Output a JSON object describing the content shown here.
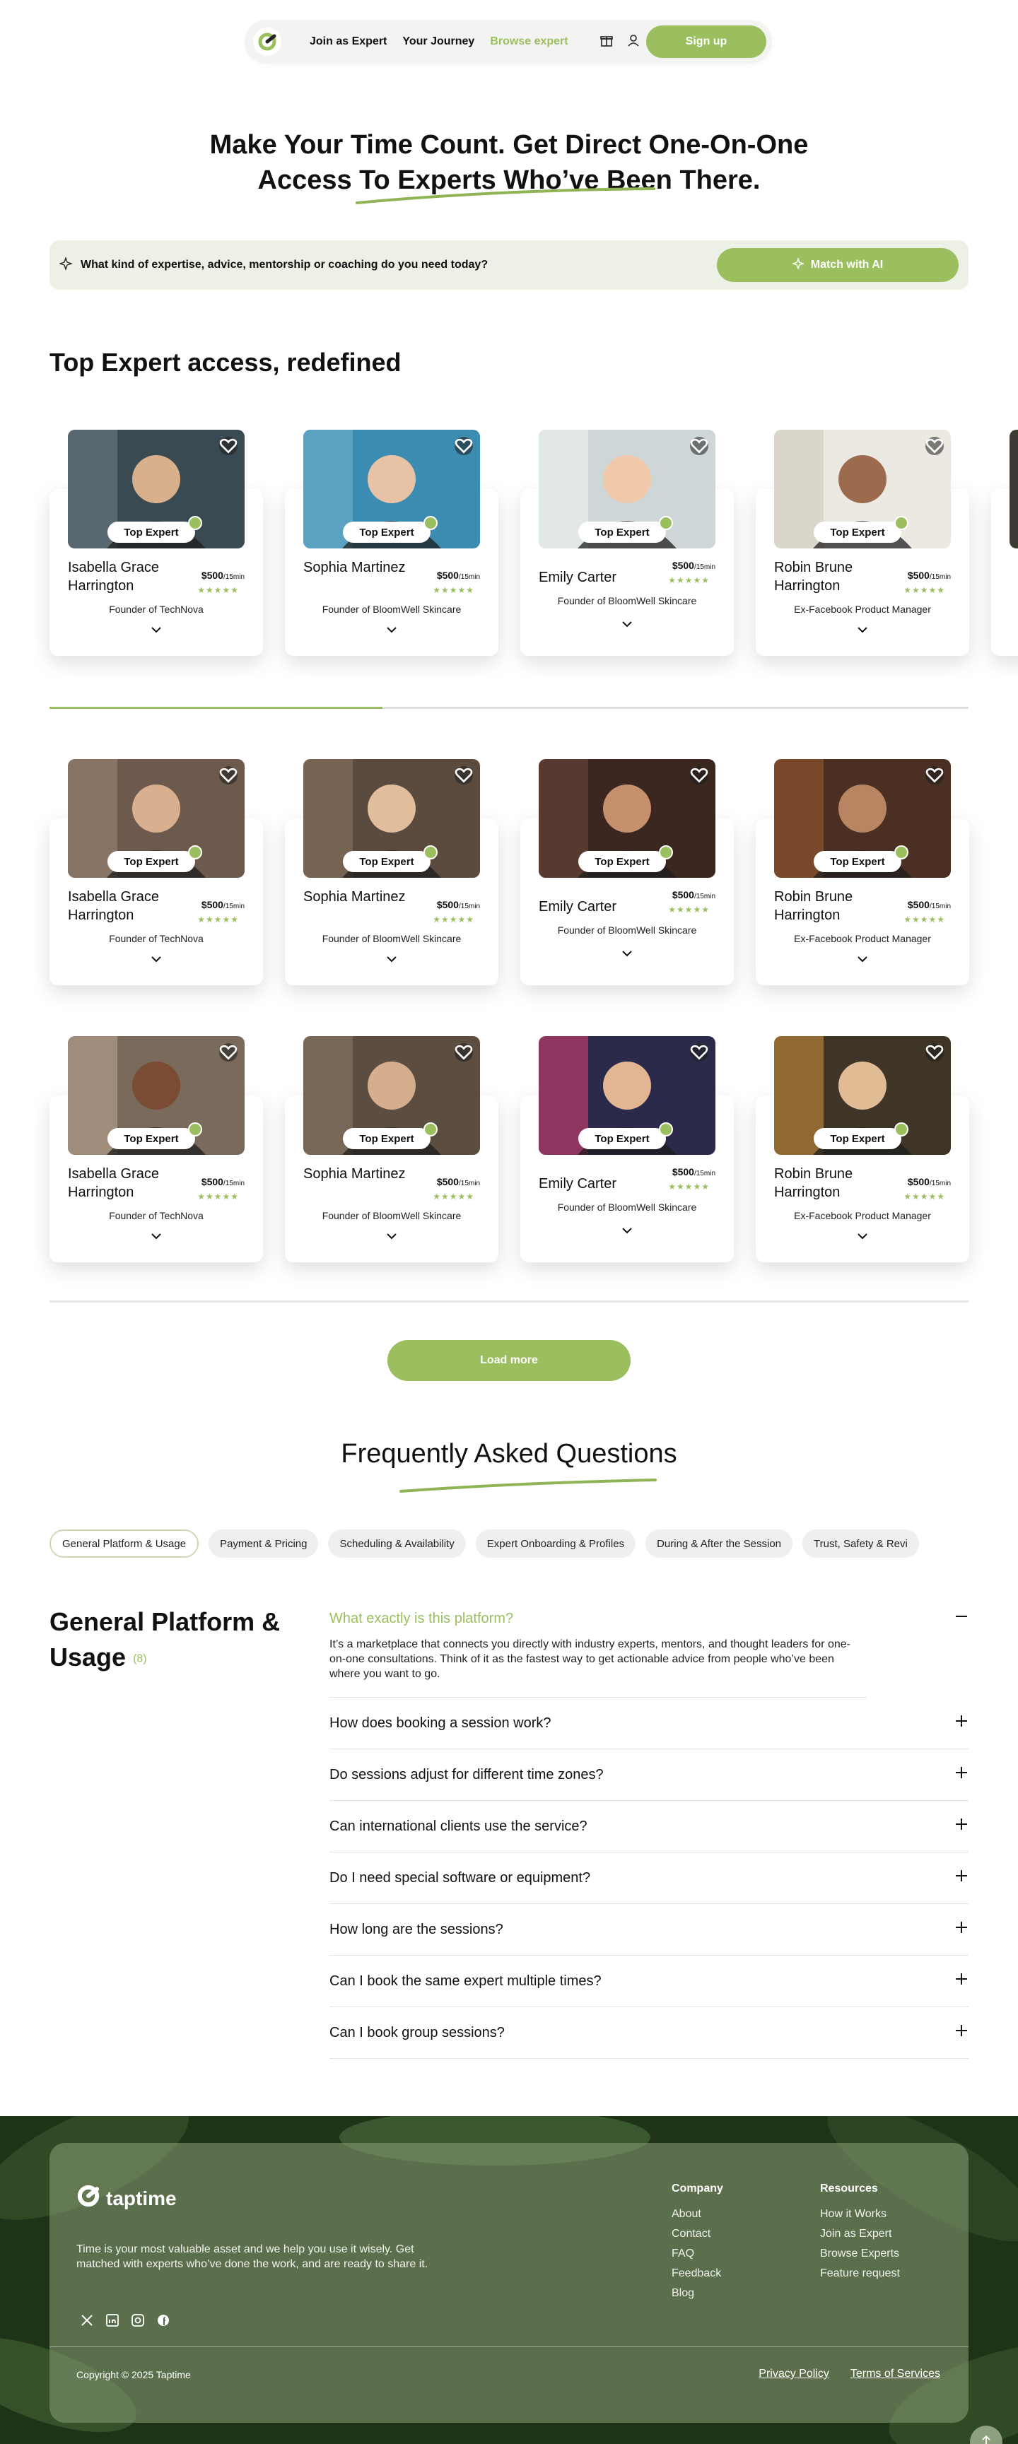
{
  "nav": {
    "links": [
      "Join as Expert",
      "Your Journey",
      "Browse expert"
    ],
    "signup": "Sign up"
  },
  "hero": {
    "line1": "Make Your Time Count. Get Direct One-On-One",
    "line2": "Access To Experts Who’ve Been There."
  },
  "match": {
    "prompt": "What kind of expertise, advice, mentorship or coaching do you need today?",
    "button": "Match with AI"
  },
  "section_title": "Top Expert access, redefined",
  "badge": "Top Expert",
  "price_unit": "/15min",
  "rating_stars": "★★★★★",
  "experts": [
    {
      "name": "Isabella Grace Harrington",
      "price": "$500",
      "role": "Founder of TechNova"
    },
    {
      "name": "Sophia Martinez",
      "price": "$500",
      "role": "Founder of BloomWell Skincare"
    },
    {
      "name": "Emily Carter",
      "price": "$500",
      "role": "Founder of BloomWell Skincare"
    },
    {
      "name": "Robin Brune Harrington",
      "price": "$500",
      "role": "Ex-Facebook Product Manager"
    }
  ],
  "load_more": "Load more",
  "faq": {
    "title": "Frequently Asked Questions",
    "tabs": [
      "General Platform & Usage",
      "Payment & Pricing",
      "Scheduling & Availability",
      "Expert Onboarding & Profiles",
      "During & After the Session",
      "Trust, Safety & Revi"
    ],
    "category": "General Platform & Usage",
    "count": "(8)",
    "open_question": "What exactly is this platform?",
    "open_answer": "It’s a marketplace that connects you directly with industry experts, mentors, and thought leaders for one-on-one consultations. Think of it as the fastest way to get actionable advice from people who’ve been where you want to go.",
    "questions": [
      "How does booking a session work?",
      "Do sessions adjust for different time zones?",
      "Can international clients use the service?",
      "Do I need special software or equipment?",
      "How long are the sessions?",
      "Can I book the same expert multiple times?",
      "Can I book group sessions?"
    ]
  },
  "footer": {
    "brand": "taptime",
    "description": "Time is your most valuable asset and we help you use it wisely. Get matched with experts who’ve done the work, and are ready to share it.",
    "company_title": "Company",
    "company_links": [
      "About",
      "Contact",
      "FAQ",
      "Feedback",
      "Blog"
    ],
    "resources_title": "Resources",
    "resources_links": [
      "How it Works",
      "Join as Expert",
      "Browse Experts",
      "Feature request"
    ],
    "copyright": "Copyright © 2025 Taptime",
    "privacy": "Privacy Policy",
    "terms": "Terms of Services"
  },
  "colors": {
    "accent": "#9bbf5f",
    "match_bg": "#edf0e4",
    "footer_bg": "#1f3317"
  },
  "carousel_progress": 0.125
}
